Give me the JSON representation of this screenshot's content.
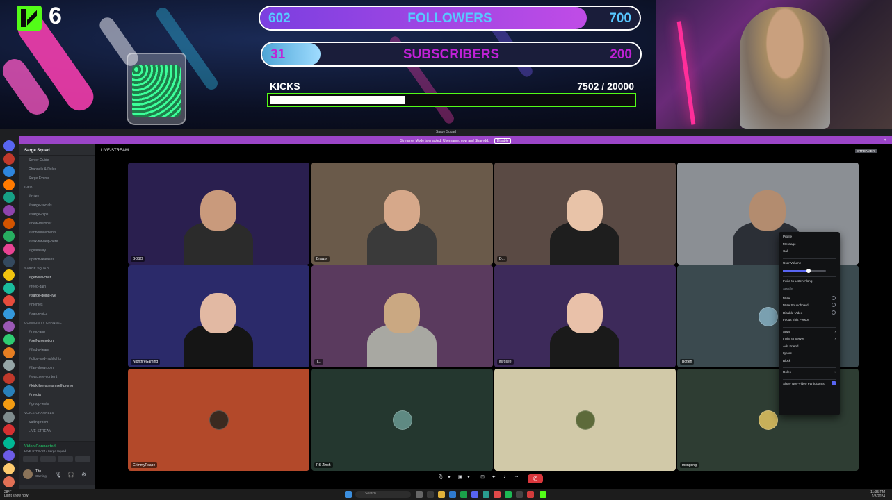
{
  "overlay": {
    "kick_count": "6",
    "followers": {
      "current": "602",
      "label": "FOLLOWERS",
      "goal": "700",
      "progress": 0.86
    },
    "subscribers": {
      "current": "31",
      "label": "SUBSCRIBERS",
      "goal": "200",
      "progress": 0.155
    },
    "kicks": {
      "label": "KICKS",
      "count": "7502  / 20000",
      "progress": 0.375
    },
    "colors": {
      "kick_green": "#53fc18",
      "followers_purple": "#a040e0",
      "followers_text": "#58c8ff",
      "subs_text": "#c021d6"
    }
  },
  "discord": {
    "window_title": "Sarge Squad",
    "notice": "Streamer Mode is enabled. Username, now and Sharedd.",
    "notice_button": "Disable",
    "server_name": "Sarge Squad",
    "channels": [
      {
        "label": "Server Guide",
        "kind": "item"
      },
      {
        "label": "Channels & Roles",
        "kind": "item"
      },
      {
        "label": "Sarge Events",
        "kind": "item"
      },
      {
        "label": "info",
        "kind": "category"
      },
      {
        "label": "# rules",
        "kind": "item"
      },
      {
        "label": "# sarge-socials",
        "kind": "item"
      },
      {
        "label": "# sarge-clips",
        "kind": "item"
      },
      {
        "label": "# new-member",
        "kind": "item"
      },
      {
        "label": "# announcements",
        "kind": "item"
      },
      {
        "label": "# ask-for-help-here",
        "kind": "item"
      },
      {
        "label": "# giveaway",
        "kind": "item"
      },
      {
        "label": "# patch-releases",
        "kind": "item"
      },
      {
        "label": "SARGE SQUAD",
        "kind": "category"
      },
      {
        "label": "# general-chat",
        "kind": "bright"
      },
      {
        "label": "# feed-gain",
        "kind": "item"
      },
      {
        "label": "# sarge-going-live",
        "kind": "bright"
      },
      {
        "label": "# memes",
        "kind": "item"
      },
      {
        "label": "# sarge-pics",
        "kind": "item"
      },
      {
        "label": "community channel",
        "kind": "category"
      },
      {
        "label": "# mod-app",
        "kind": "item"
      },
      {
        "label": "# self-promotion",
        "kind": "bright"
      },
      {
        "label": "# find-a-team",
        "kind": "item"
      },
      {
        "label": "# clips-and-highlights",
        "kind": "item"
      },
      {
        "label": "# fan-showroom",
        "kind": "item"
      },
      {
        "label": "# warzone-content",
        "kind": "item"
      },
      {
        "label": "# kick-live-stream-self-promo",
        "kind": "bright"
      },
      {
        "label": "# media",
        "kind": "bright"
      },
      {
        "label": "# group-texts",
        "kind": "item"
      },
      {
        "label": "Voice Channels",
        "kind": "category"
      },
      {
        "label": "waiting room",
        "kind": "item"
      },
      {
        "label": "LIVE-STREAM",
        "kind": "item"
      }
    ],
    "voice": {
      "status": "Video Connected",
      "channel": "LIVE-STREAM / Sarge Squad"
    },
    "user": {
      "name": "Tito",
      "status": "Gaming"
    },
    "stage": {
      "title": "LIVE-STREAM",
      "badge": "STREAMER",
      "tiles": [
        {
          "name": "BOSO",
          "bg": "#2a1f4f",
          "kind": "cam",
          "head": "#c99a7c",
          "shirt": "#2b2b2b"
        },
        {
          "name": "Brawsy",
          "bg": "#6a5a4a",
          "kind": "cam",
          "head": "#d6a88a",
          "shirt": "#3a3a3a"
        },
        {
          "name": "D...",
          "bg": "#5a4a44",
          "kind": "cam",
          "head": "#e8c3a8",
          "shirt": "#1e1e1e"
        },
        {
          "name": "",
          "bg": "#8b8f94",
          "kind": "cam",
          "head": "#b38c6f",
          "shirt": "#2b2f36"
        },
        {
          "name": "NightfireGaming",
          "bg": "#2b2a6a",
          "kind": "cam",
          "head": "#e2b9a3",
          "shirt": "#151515"
        },
        {
          "name": "T...",
          "bg": "#5a3a5e",
          "kind": "cam",
          "head": "#caa882",
          "shirt": "#a8a8a2"
        },
        {
          "name": "itsrosee",
          "bg": "#3d2a5a",
          "kind": "cam",
          "head": "#e9c1a9",
          "shirt": "#1a1a1a"
        },
        {
          "name": "Botten",
          "bg": "#3b4a4f",
          "kind": "avatar",
          "avatar_color": "#7aa0b0"
        },
        {
          "name": "GrimmyReape",
          "bg": "#b3492a",
          "kind": "avatar",
          "avatar_color": "#3a2a20"
        },
        {
          "name": "RS Zinch",
          "bg": "#24372f",
          "kind": "avatar",
          "avatar_color": "#5f8a83"
        },
        {
          "name": "",
          "bg": "#d1c9a8",
          "kind": "avatar",
          "avatar_color": "#5d6a3a"
        },
        {
          "name": "mongong",
          "bg": "#2e3d33",
          "kind": "avatar",
          "avatar_color": "#c8b05a"
        }
      ]
    },
    "context_menu": {
      "items": [
        {
          "label": "Profile",
          "kind": "item"
        },
        {
          "label": "Message",
          "kind": "item"
        },
        {
          "label": "Call",
          "kind": "item"
        },
        {
          "label": "sep",
          "kind": "sep"
        },
        {
          "label": "User Volume",
          "kind": "item"
        },
        {
          "label": "slider",
          "kind": "slider"
        },
        {
          "label": "sep",
          "kind": "sep"
        },
        {
          "label": "Invite to Listen Along",
          "kind": "item"
        },
        {
          "label": "Spotify",
          "kind": "sub"
        },
        {
          "label": "sep",
          "kind": "sep"
        },
        {
          "label": "Mute",
          "kind": "check"
        },
        {
          "label": "Mute Soundboard",
          "kind": "check"
        },
        {
          "label": "Disable Video",
          "kind": "check"
        },
        {
          "label": "Focus This Person",
          "kind": "item"
        },
        {
          "label": "sep",
          "kind": "sep"
        },
        {
          "label": "Apps",
          "kind": "arrow"
        },
        {
          "label": "Invite to Server",
          "kind": "arrow"
        },
        {
          "label": "Add Friend",
          "kind": "item"
        },
        {
          "label": "Ignore",
          "kind": "item"
        },
        {
          "label": "Block",
          "kind": "item"
        },
        {
          "label": "sep",
          "kind": "sep"
        },
        {
          "label": "Roles",
          "kind": "arrow"
        },
        {
          "label": "sep",
          "kind": "sep"
        },
        {
          "label": "Show Non-Video Participants",
          "kind": "checked"
        }
      ],
      "user_volume_fraction": 0.6
    }
  },
  "taskbar": {
    "weather_temp": "28°F",
    "weather_desc": "Light snow now",
    "search_placeholder": "Search",
    "time": "11:35 PM",
    "date": "1/3/2024"
  }
}
